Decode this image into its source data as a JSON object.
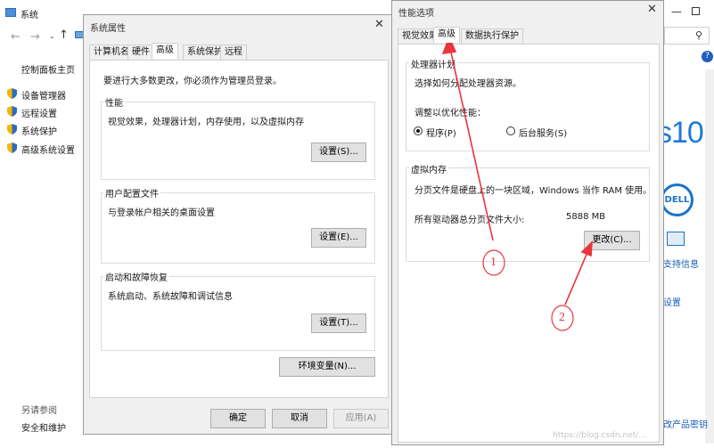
{
  "bg_window": {
    "title": "系统",
    "sidebar": {
      "home": "控制面板主页",
      "items": [
        "设备管理器",
        "远程设置",
        "系统保护",
        "高级系统设置"
      ],
      "see_also": "另请参阅",
      "security": "安全和维护"
    },
    "right_fragments": {
      "win10": "s10",
      "dell": "DELL",
      "support": "支持信息",
      "settings": "设置",
      "product_key": "改产品密钥",
      "help": "?"
    }
  },
  "sys_props": {
    "title": "系统属性",
    "tabs": [
      "计算机名",
      "硬件",
      "高级",
      "系统保护",
      "远程"
    ],
    "admin_note": "要进行大多数更改，你必须作为管理员登录。",
    "perf": {
      "title": "性能",
      "desc": "视觉效果，处理器计划，内存使用，以及虚拟内存",
      "btn": "设置(S)..."
    },
    "profile": {
      "title": "用户配置文件",
      "desc": "与登录帐户相关的桌面设置",
      "btn": "设置(E)..."
    },
    "startup": {
      "title": "启动和故障恢复",
      "desc": "系统启动、系统故障和调试信息",
      "btn": "设置(T)..."
    },
    "env_btn": "环境变量(N)...",
    "ok": "确定",
    "cancel": "取消",
    "apply": "应用(A)"
  },
  "perf_opts": {
    "title": "性能选项",
    "tabs": [
      "视觉效果",
      "高级",
      "数据执行保护"
    ],
    "cpu": {
      "title": "处理器计划",
      "desc": "选择如何分配处理器资源。",
      "adjust": "调整以优化性能：",
      "radio_programs": "程序(P)",
      "radio_services": "后台服务(S)"
    },
    "vm": {
      "title": "虚拟内存",
      "desc": "分页文件是硬盘上的一块区域，Windows 当作 RAM 使用。",
      "total_label": "所有驱动器总分页文件大小:",
      "total_value": "5888 MB",
      "change_btn": "更改(C)..."
    }
  },
  "annotations": {
    "one": "1",
    "two": "2"
  },
  "watermark": "https://blog.csdn.net/..."
}
